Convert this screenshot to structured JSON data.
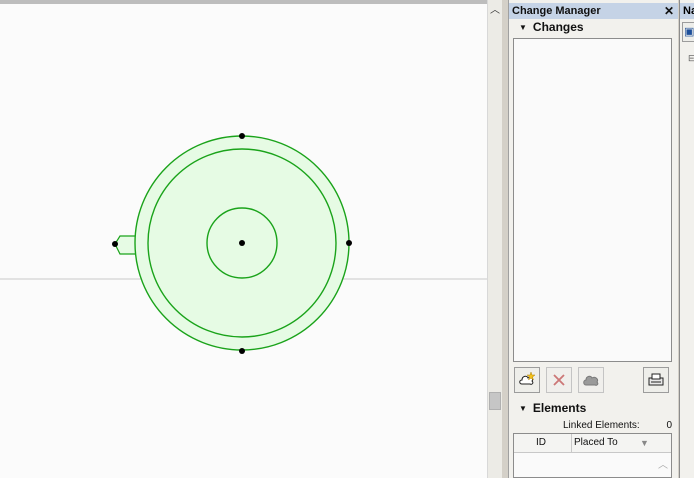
{
  "canvas": {
    "element_color": "#1aa31a",
    "fill_color": "#e6fbe4",
    "background": "#fbfbfb"
  },
  "scrollbar": {
    "up_arrow_icon": "chevron-up-icon"
  },
  "change_manager": {
    "title": "Change Manager",
    "close_icon": "close-icon",
    "changes_section": {
      "label": "Changes",
      "expanded": true
    },
    "toolbar": {
      "new_change_icon": "new-change-icon",
      "delete_icon": "delete-icon",
      "cloud_icon": "cloud-icon",
      "settings_icon": "printer-settings-icon"
    },
    "elements_section": {
      "label": "Elements",
      "expanded": true,
      "linked_elements_label": "Linked Elements:",
      "linked_elements_count": "0",
      "columns": [
        "ID",
        "Placed To"
      ]
    }
  },
  "navigator": {
    "title": "Na"
  }
}
